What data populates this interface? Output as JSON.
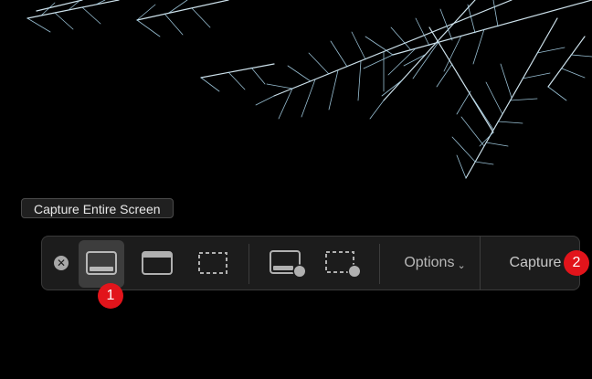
{
  "tooltip": {
    "text": "Capture Entire Screen"
  },
  "toolbar": {
    "close_icon": "close-icon",
    "modes": [
      {
        "name": "capture-entire-screen",
        "icon": "entire-screen-icon",
        "selected": true
      },
      {
        "name": "capture-selected-window",
        "icon": "window-icon",
        "selected": false
      },
      {
        "name": "capture-selected-portion",
        "icon": "selection-icon",
        "selected": false
      },
      {
        "name": "record-entire-screen",
        "icon": "record-screen-icon",
        "selected": false
      },
      {
        "name": "record-selected-portion",
        "icon": "record-selection-icon",
        "selected": false
      }
    ],
    "options_label": "Options",
    "options_chevron": "⌄",
    "capture_label": "Capture"
  },
  "markers": {
    "one": "1",
    "two": "2"
  },
  "colors": {
    "background": "#000000",
    "toolbar_bg": "#1c1c1c",
    "selected_bg": "#3d3d3d",
    "icon": "#b0b0b0",
    "marker": "#e2141b",
    "ice": "#cfe9f5"
  }
}
